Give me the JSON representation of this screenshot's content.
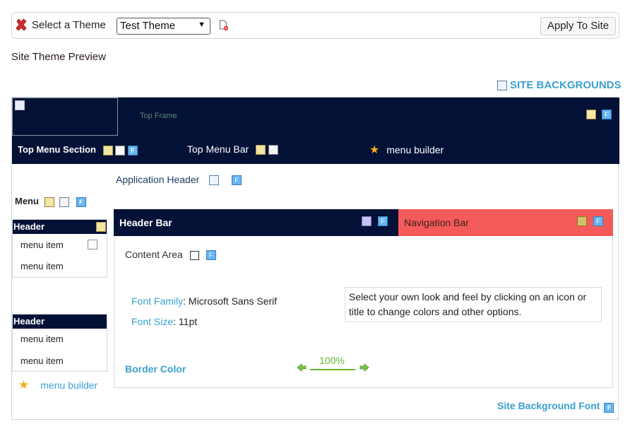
{
  "toolbar": {
    "title": "Select a Theme",
    "theme_select": {
      "value": "Test Theme"
    },
    "apply_label": "Apply To Site"
  },
  "preview": {
    "title": "Site Theme Preview",
    "site_backgrounds": "SITE BACKGROUNDS",
    "top_frame": "Top Frame",
    "top_menu_section": "Top Menu Section",
    "top_menu_bar": "Top Menu Bar",
    "menu_builder_top": "menu builder",
    "application_header": "Application Header",
    "menu_label": "Menu",
    "left_menu": [
      {
        "header": "Header",
        "items": [
          "menu item",
          "menu item"
        ]
      },
      {
        "header": "Header",
        "items": [
          "menu item",
          "menu item"
        ]
      }
    ],
    "menu_builder_bottom": "menu builder",
    "header_bar": "Header Bar",
    "navigation_bar": "Navigation Bar",
    "content_area": "Content Area",
    "font_family_key": "Font Family",
    "font_family_value": ": Microsoft Sans Serif",
    "font_size_key": "Font Size",
    "font_size_value": ": 11pt",
    "note": "Select your own look and feel by clicking on an icon or title to change colors and other options.",
    "border_color": "Border Color",
    "zoom_percent": "100%",
    "site_background_font": "Site Background Font",
    "f_icon_letter": "F"
  },
  "colors": {
    "frame_navy": "#031136",
    "navigation_red": "#f55a5a",
    "link_blue": "#3aa0d0",
    "zoom_green": "#6ab82a"
  }
}
